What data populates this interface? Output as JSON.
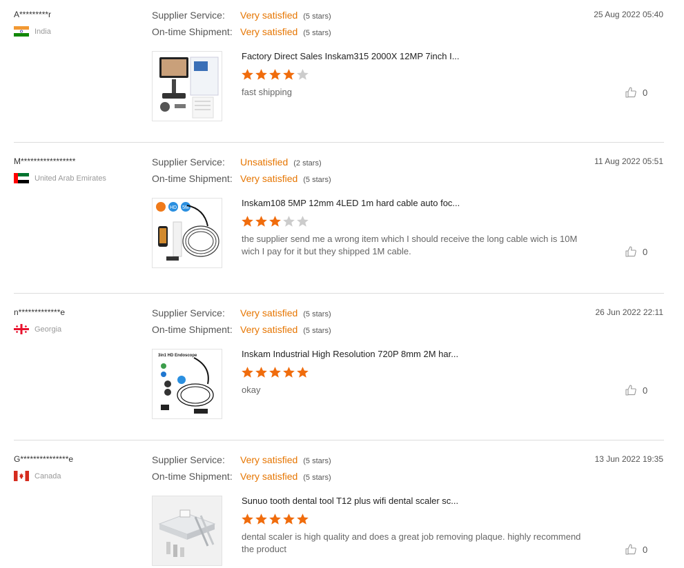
{
  "reviews": [
    {
      "buyer": "A*********r",
      "country": "India",
      "flag": "india-flag",
      "supplier_label": "Supplier Service:",
      "supplier_value": "Very satisfied",
      "supplier_stars": "(5 stars)",
      "shipment_label": "On-time Shipment:",
      "shipment_value": "Very satisfied",
      "shipment_stars": "(5 stars)",
      "date": "25 Aug 2022 05:40",
      "product": "Factory Direct Sales Inskam315 2000X 12MP 7inch I...",
      "rating": 4,
      "comment": "fast shipping",
      "likes": "0"
    },
    {
      "buyer": "M*****************",
      "country": "United Arab Emirates",
      "flag": "uae-flag",
      "supplier_label": "Supplier Service:",
      "supplier_value": "Unsatisfied",
      "supplier_stars": "(2 stars)",
      "shipment_label": "On-time Shipment:",
      "shipment_value": "Very satisfied",
      "shipment_stars": "(5 stars)",
      "date": "11 Aug 2022 05:51",
      "product": "Inskam108 5MP 12mm 4LED 1m hard cable auto foc...",
      "rating": 3,
      "comment": "the supplier send me a wrong item which I should receive the long cable wich is 10M wich I pay for it but they shipped 1M cable.",
      "likes": "0"
    },
    {
      "buyer": "n*************e",
      "country": "Georgia",
      "flag": "georgia-flag",
      "supplier_label": "Supplier Service:",
      "supplier_value": "Very satisfied",
      "supplier_stars": "(5 stars)",
      "shipment_label": "On-time Shipment:",
      "shipment_value": "Very satisfied",
      "shipment_stars": "(5 stars)",
      "date": "26 Jun 2022 22:11",
      "product": "Inskam Industrial High Resolution 720P 8mm 2M har...",
      "rating": 5,
      "comment": "okay",
      "likes": "0"
    },
    {
      "buyer": "G***************e",
      "country": "Canada",
      "flag": "canada-flag",
      "supplier_label": "Supplier Service:",
      "supplier_value": "Very satisfied",
      "supplier_stars": "(5 stars)",
      "shipment_label": "On-time Shipment:",
      "shipment_value": "Very satisfied",
      "shipment_stars": "(5 stars)",
      "date": "13 Jun 2022 19:35",
      "product": "Sunuo tooth dental tool T12 plus wifi dental scaler sc...",
      "rating": 5,
      "comment": "dental scaler is high quality and does a great job removing plaque.  highly recommend the product",
      "likes": "0"
    }
  ],
  "thumb_labels": {
    "r2_badge_hd": "HD",
    "r2_badge_5m": "5M",
    "r3_caption": "3in1 HD Endoscope"
  },
  "colors": {
    "accent": "#e67500",
    "star_on": "#f06c0c",
    "star_off": "#cccccc"
  }
}
